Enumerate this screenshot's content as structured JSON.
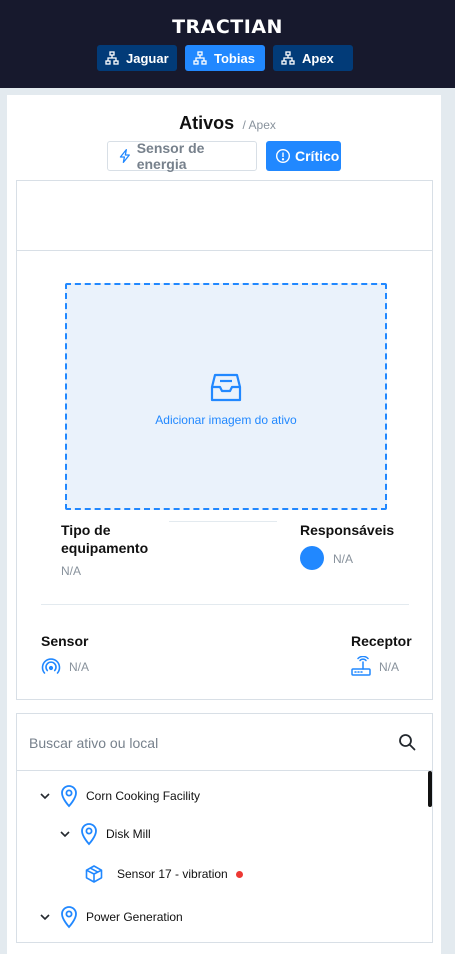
{
  "header": {
    "logo": "TRACTIAN",
    "companies": [
      {
        "label": "Jaguar",
        "active": false
      },
      {
        "label": "Tobias",
        "active": true
      },
      {
        "label": "Apex",
        "active": false
      }
    ]
  },
  "page": {
    "title": "Ativos",
    "breadcrumb": "/ Apex"
  },
  "filters": {
    "energy_label": "Sensor de energia",
    "critical_label": "Crítico"
  },
  "asset_detail": {
    "image_upload_label": "Adicionar imagem do ativo",
    "equipment_type_label": "Tipo de equipamento",
    "equipment_type_value": "N/A",
    "responsibles_label": "Responsáveis",
    "responsibles_value": "N/A",
    "sensor_label": "Sensor",
    "sensor_value": "N/A",
    "receiver_label": "Receptor",
    "receiver_value": "N/A"
  },
  "tree": {
    "search_placeholder": "Buscar ativo ou local",
    "items": [
      {
        "label": "Corn Cooking Facility",
        "type": "location",
        "expanded": true
      },
      {
        "label": "Disk Mill",
        "type": "location",
        "expanded": true
      },
      {
        "label": "Sensor 17 - vibration",
        "type": "component",
        "status": "critical"
      },
      {
        "label": "Power Generation",
        "type": "location",
        "expanded": true
      }
    ]
  },
  "colors": {
    "header_bg": "#17192d",
    "primary": "#2188ff",
    "company_btn": "#023b78",
    "critical": "#ed3833"
  }
}
